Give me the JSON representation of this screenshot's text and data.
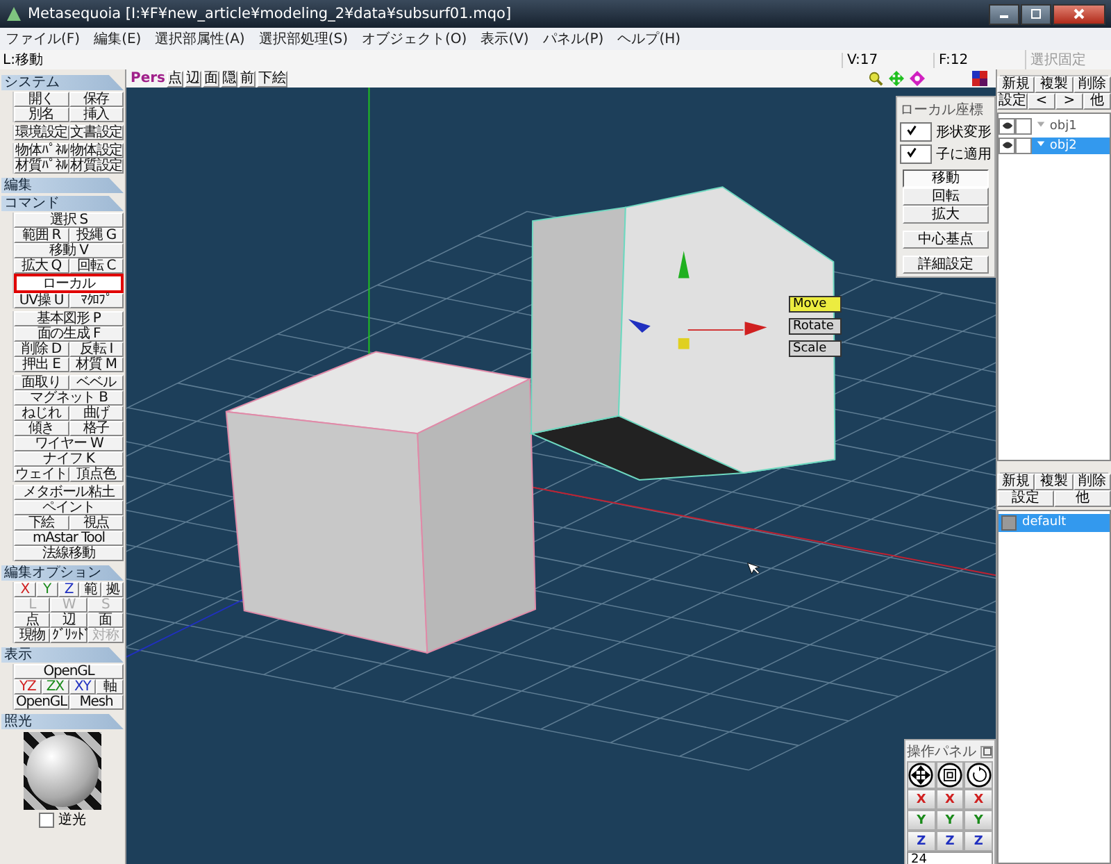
{
  "window": {
    "title": "Metasequoia [I:¥F¥new_article¥modeling_2¥data¥subsurf01.mqo]"
  },
  "menu": [
    "ファイル(F)",
    "編集(E)",
    "選択部属性(A)",
    "選択部処理(S)",
    "オブジェクト(O)",
    "表示(V)",
    "パネル(P)",
    "ヘルプ(H)"
  ],
  "status": {
    "mode": "L:移動",
    "vertices": "V:17",
    "faces": "F:12",
    "lock": "選択固定"
  },
  "left_panel": [
    {
      "title": "システム",
      "groups": [
        [
          [
            {
              "label": "開く"
            },
            {
              "label": "保存"
            }
          ],
          [
            {
              "label": "別名"
            },
            {
              "label": "挿入"
            }
          ]
        ],
        [
          [
            {
              "label": "環境設定"
            },
            {
              "label": "文書設定"
            }
          ]
        ],
        [
          [
            {
              "label": "物体ﾊﾟﾈﾙ"
            },
            {
              "label": "物体設定"
            }
          ],
          [
            {
              "label": "材質ﾊﾟﾈﾙ"
            },
            {
              "label": "材質設定"
            }
          ]
        ]
      ]
    },
    {
      "title": "編集"
    },
    {
      "title": "コマンド",
      "groups": [
        [
          [
            {
              "label": "選択 S",
              "selected": false
            }
          ],
          [
            {
              "label": "範囲 R",
              "selected": false
            },
            {
              "label": "投縄 G",
              "selected": false
            }
          ],
          [
            {
              "label": "移動 V",
              "selected": false
            }
          ],
          [
            {
              "label": "拡大 Q",
              "selected": false
            },
            {
              "label": "回転 C",
              "selected": false
            }
          ],
          [
            {
              "label": "ローカル",
              "selected": true
            }
          ],
          [
            {
              "label": "UV操 U",
              "selected": false
            },
            {
              "label": "ﾏｸﾛﾌﾟ",
              "selected": false
            }
          ]
        ],
        [
          [
            {
              "label": "基本図形 P",
              "selected": false
            }
          ],
          [
            {
              "label": "面の生成 F",
              "selected": false
            }
          ],
          [
            {
              "label": "削除 D",
              "selected": false
            },
            {
              "label": "反転 I",
              "selected": false
            }
          ],
          [
            {
              "label": "押出 E",
              "selected": false
            },
            {
              "label": "材質 M",
              "selected": false
            }
          ]
        ],
        [
          [
            {
              "label": "面取り",
              "selected": false
            },
            {
              "label": "ベベル",
              "selected": false
            }
          ],
          [
            {
              "label": "マグネット B",
              "selected": false
            }
          ],
          [
            {
              "label": "ねじれ",
              "selected": false
            },
            {
              "label": "曲げ",
              "selected": false
            }
          ],
          [
            {
              "label": "傾き",
              "selected": false
            },
            {
              "label": "格子",
              "selected": false
            }
          ],
          [
            {
              "label": "ワイヤー W",
              "selected": false
            }
          ],
          [
            {
              "label": "ナイフ K",
              "selected": false
            }
          ],
          [
            {
              "label": "ウェイト",
              "selected": false
            },
            {
              "label": "頂点色",
              "selected": false
            }
          ]
        ],
        [
          [
            {
              "label": "メタボール粘土",
              "selected": false
            }
          ],
          [
            {
              "label": "ペイント",
              "selected": false
            }
          ],
          [
            {
              "label": "下絵",
              "selected": false
            },
            {
              "label": "視点",
              "selected": false
            }
          ],
          [
            {
              "label": "mAstar Tool",
              "selected": false
            }
          ],
          [
            {
              "label": "法線移動",
              "selected": false
            }
          ]
        ]
      ]
    },
    {
      "title": "編集オプション",
      "groups": [
        [
          [
            {
              "label": "X",
              "color": "#d02020",
              "disabled": false
            },
            {
              "label": "Y",
              "color": "#1a8a1a",
              "disabled": false
            },
            {
              "label": "Z",
              "color": "#2030c0",
              "disabled": false
            },
            {
              "label": "範",
              "disabled": false
            },
            {
              "label": "拠",
              "disabled": false
            }
          ],
          [
            {
              "label": "L",
              "disabled": true
            },
            {
              "label": "W",
              "disabled": true
            },
            {
              "label": "S",
              "disabled": true
            }
          ],
          [
            {
              "label": "点",
              "disabled": false
            },
            {
              "label": "辺",
              "disabled": false
            },
            {
              "label": "面",
              "disabled": false
            }
          ],
          [
            {
              "label": "現物",
              "disabled": false
            },
            {
              "label": "ｸﾞﾘｯﾄﾞ",
              "disabled": false
            },
            {
              "label": "対称",
              "disabled": true
            }
          ]
        ]
      ]
    },
    {
      "title": "表示",
      "groups": [
        [
          [
            {
              "label": "OpenGL"
            }
          ],
          [
            {
              "label": "YZ",
              "color": "#d02020"
            },
            {
              "label": "ZX",
              "color": "#1a8a1a"
            },
            {
              "label": "XY",
              "color": "#2030c0"
            },
            {
              "label": "軸"
            }
          ],
          [
            {
              "label": "OpenGL"
            },
            {
              "label": "Mesh"
            }
          ]
        ]
      ]
    },
    {
      "title": "照光"
    }
  ],
  "light": {
    "reverse": {
      "label": "逆光",
      "checked": false
    }
  },
  "viewport": {
    "view_mode": "Pers",
    "buttons": [
      "点",
      "辺",
      "面",
      "隠",
      "前",
      "下絵"
    ],
    "handles": [
      {
        "label": "Move",
        "selected": true
      },
      {
        "label": "Rotate",
        "selected": false
      },
      {
        "label": "Scale",
        "selected": false
      }
    ],
    "local_panel": {
      "title": "ローカル座標",
      "options": [
        {
          "label": "形状変形",
          "checked": true
        },
        {
          "label": "子に適用",
          "checked": true
        }
      ],
      "modes": [
        {
          "label": "移動",
          "selected": true
        },
        {
          "label": "回転",
          "selected": false
        },
        {
          "label": "拡大",
          "selected": false
        }
      ],
      "buttons": [
        "中心基点",
        "詳細設定"
      ]
    },
    "op_panel": {
      "title": "操作パネル",
      "axes": [
        [
          {
            "label": "X",
            "color": "#d02020"
          },
          {
            "label": "X",
            "color": "#d02020"
          },
          {
            "label": "X",
            "color": "#d02020"
          }
        ],
        [
          {
            "label": "Y",
            "color": "#1a8a1a"
          },
          {
            "label": "Y",
            "color": "#1a8a1a"
          },
          {
            "label": "Y",
            "color": "#1a8a1a"
          }
        ],
        [
          {
            "label": "Z",
            "color": "#2030c0"
          },
          {
            "label": "Z",
            "color": "#2030c0"
          },
          {
            "label": "Z",
            "color": "#2030c0"
          }
        ]
      ],
      "value": "24"
    }
  },
  "object_panel": {
    "buttons": [
      [
        "新規",
        "複製",
        "削除"
      ],
      [
        "設定",
        "<",
        ">",
        "他"
      ]
    ],
    "objects": [
      {
        "name": "obj1",
        "selected": false
      },
      {
        "name": "obj2",
        "selected": true
      }
    ]
  },
  "material_panel": {
    "buttons": [
      [
        "新規",
        "複製",
        "削除"
      ],
      [
        "設定",
        "他"
      ]
    ],
    "materials": [
      {
        "name": "default",
        "selected": true
      }
    ]
  }
}
